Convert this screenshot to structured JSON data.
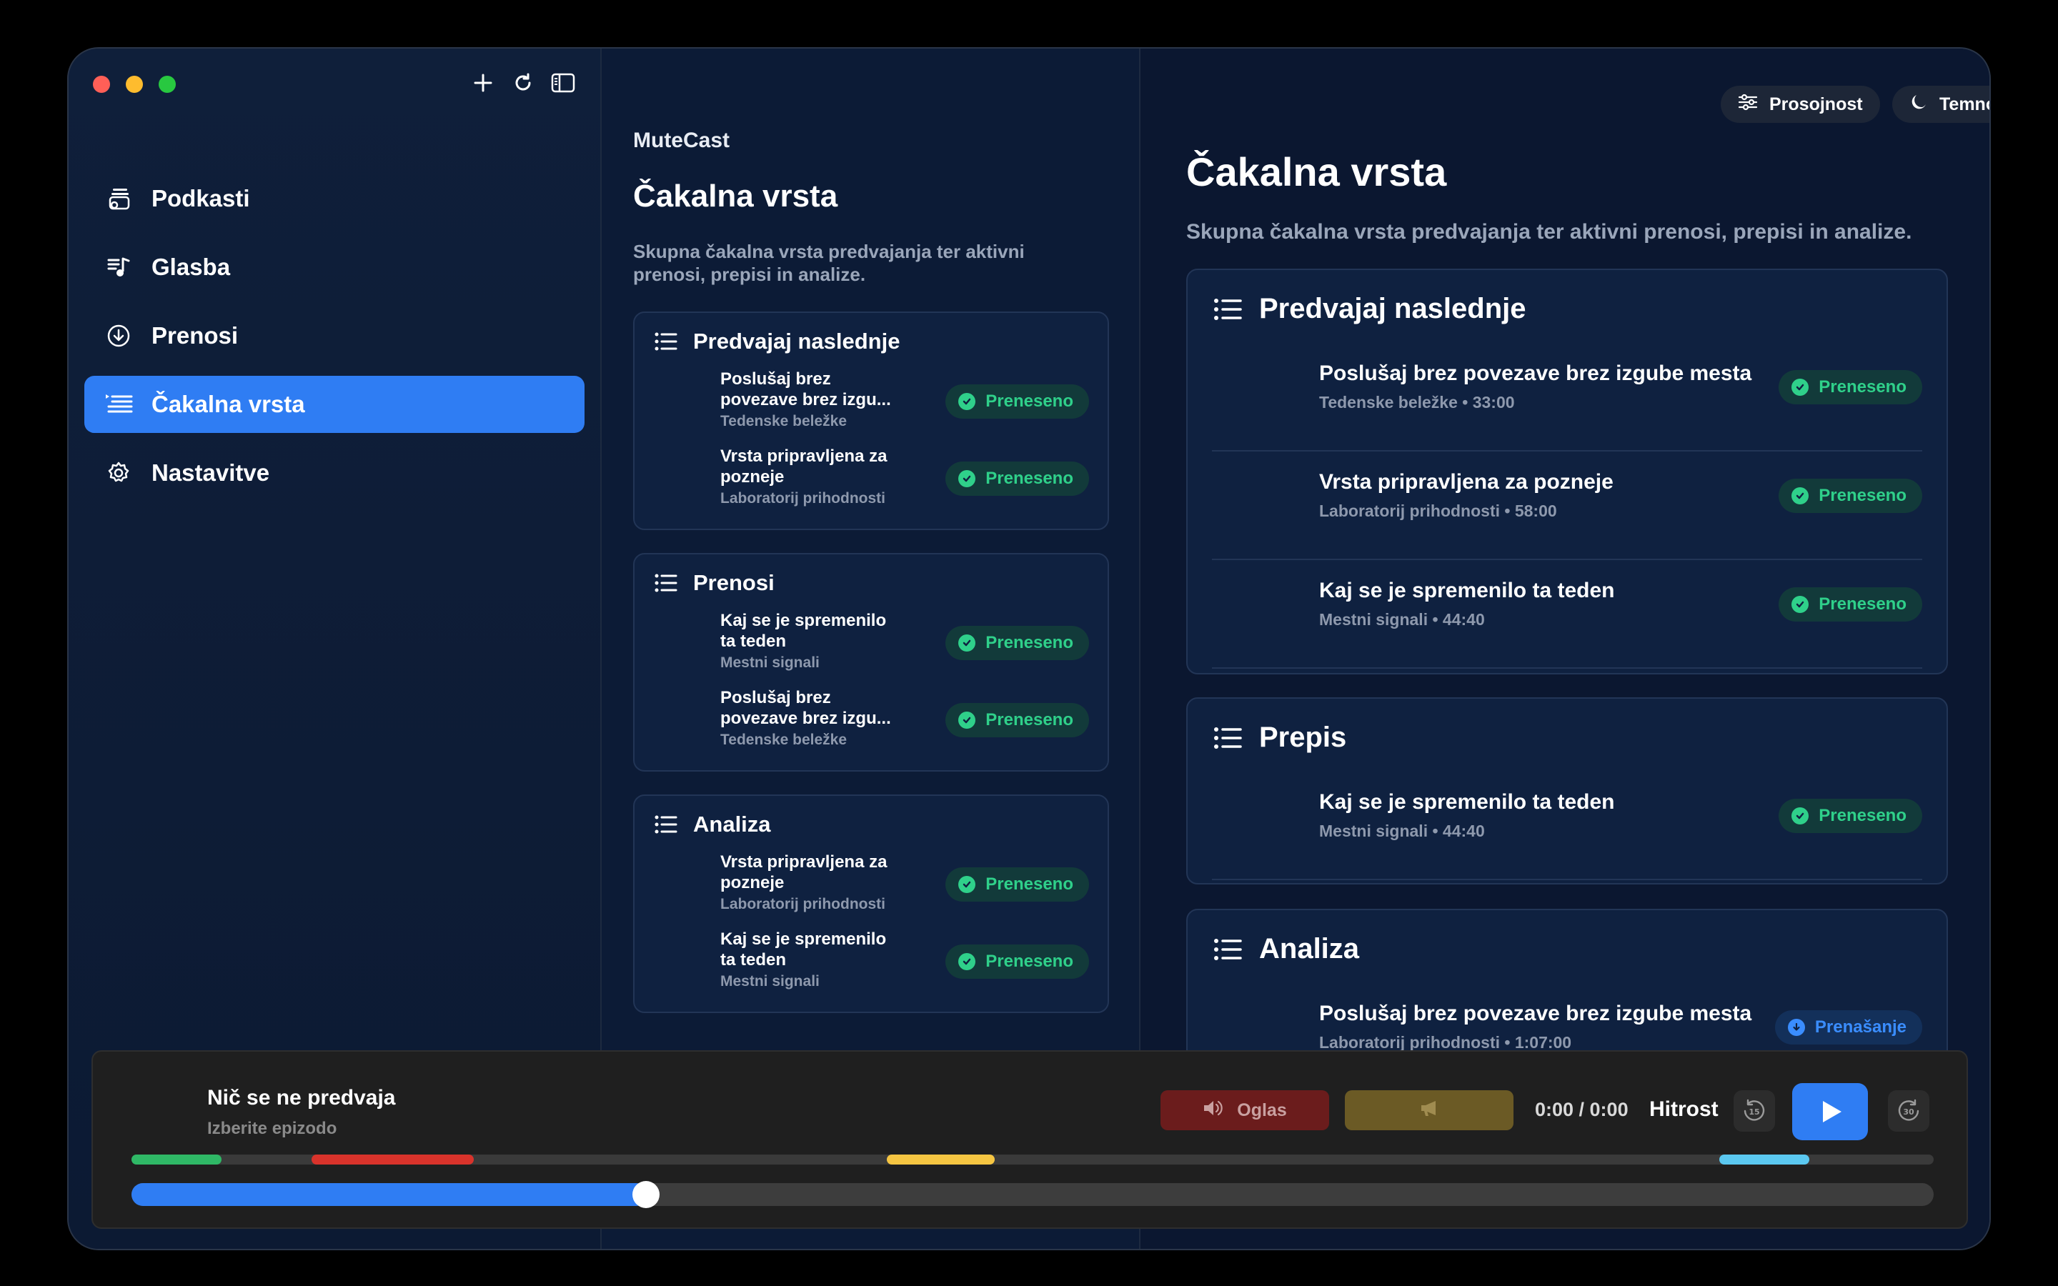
{
  "sidebar": {
    "items": [
      {
        "label": "Podkasti",
        "icon": "podcasts-icon"
      },
      {
        "label": "Glasba",
        "icon": "music-icon"
      },
      {
        "label": "Prenosi",
        "icon": "download-icon"
      },
      {
        "label": "Čakalna vrsta",
        "icon": "queue-icon",
        "active": true
      },
      {
        "label": "Nastavitve",
        "icon": "gear-icon"
      }
    ],
    "tools": [
      "plus-icon",
      "refresh-icon",
      "sidebar-toggle-icon"
    ]
  },
  "middle": {
    "app_name": "MuteCast",
    "title": "Čakalna vrsta",
    "subtitle": "Skupna čakalna vrsta predvajanja ter aktivni prenosi, prepisi in analize.",
    "sections": [
      {
        "title": "Predvajaj naslednje",
        "rows": [
          {
            "title": "Poslušaj brez povezave brez izgu...",
            "subtitle": "Tedenske beležke",
            "status": "Preneseno"
          },
          {
            "title": "Vrsta pripravljena za pozneje",
            "subtitle": "Laboratorij prihodnosti",
            "status": "Preneseno"
          }
        ]
      },
      {
        "title": "Prenosi",
        "rows": [
          {
            "title": "Kaj se je spremenilo ta teden",
            "subtitle": "Mestni signali",
            "status": "Preneseno"
          },
          {
            "title": "Poslušaj brez povezave brez izgu...",
            "subtitle": "Tedenske beležke",
            "status": "Preneseno"
          }
        ]
      },
      {
        "title": "Analiza",
        "rows": [
          {
            "title": "Vrsta pripravljena za pozneje",
            "subtitle": "Laboratorij prihodnosti",
            "status": "Preneseno"
          },
          {
            "title": "Kaj se je spremenilo ta teden",
            "subtitle": "Mestni signali",
            "status": "Preneseno"
          }
        ]
      }
    ]
  },
  "detail": {
    "pills": {
      "transparency": "Prosojnost",
      "theme": "Temno"
    },
    "title": "Čakalna vrsta",
    "subtitle": "Skupna čakalna vrsta predvajanja ter aktivni prenosi, prepisi in analize.",
    "sections": [
      {
        "title": "Predvajaj naslednje",
        "rows": [
          {
            "title": "Poslušaj brez povezave brez izgube mesta",
            "subtitle": "Tedenske beležke • 33:00",
            "status": "Preneseno"
          },
          {
            "title": "Vrsta pripravljena za pozneje",
            "subtitle": "Laboratorij prihodnosti • 58:00",
            "status": "Preneseno"
          },
          {
            "title": "Kaj se je spremenilo ta teden",
            "subtitle": "Mestni signali • 44:40",
            "status": "Preneseno"
          }
        ]
      },
      {
        "title": "Prepis",
        "rows": [
          {
            "title": "Kaj se je spremenilo ta teden",
            "subtitle": "Mestni signali • 44:40",
            "status": "Preneseno"
          }
        ]
      },
      {
        "title": "Analiza",
        "rows": [
          {
            "title": "Poslušaj brez povezave brez izgube mesta",
            "subtitle": "Laboratorij prihodnosti • 1:07:00",
            "status": "Prenašanje"
          }
        ]
      }
    ]
  },
  "player": {
    "title": "Nič se ne predvaja",
    "subtitle": "Izberite epizodo",
    "ad_label": "Oglas",
    "time": "0:00 / 0:00",
    "speed_label": "Hitrost",
    "skip_back": "15",
    "skip_forward": "30",
    "progress_fraction": 0.28,
    "segments": [
      {
        "start": 0.0,
        "end": 0.05,
        "color": "#2fb866"
      },
      {
        "start": 0.1,
        "end": 0.19,
        "color": "#d9332b"
      },
      {
        "start": 0.419,
        "end": 0.479,
        "color": "#f5c542"
      },
      {
        "start": 0.881,
        "end": 0.931,
        "color": "#5bc8f0"
      }
    ]
  },
  "colors": {
    "accent": "#2f7df3",
    "success": "#2fd08a",
    "downloading": "#3a8dff"
  }
}
